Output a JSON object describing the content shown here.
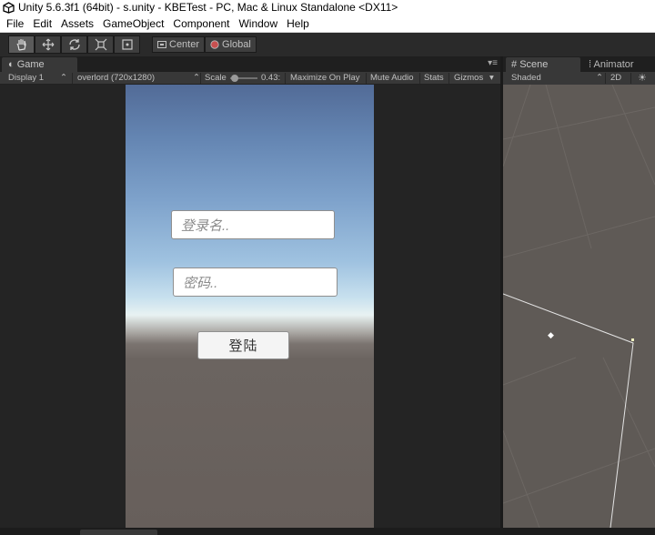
{
  "window": {
    "title": "Unity 5.6.3f1 (64bit) - s.unity - KBETest - PC, Mac & Linux Standalone <DX11>"
  },
  "menu": [
    "File",
    "Edit",
    "Assets",
    "GameObject",
    "Component",
    "Window",
    "Help"
  ],
  "toolbar": {
    "tools": [
      "hand-icon",
      "move-icon",
      "rotate-icon",
      "scale-icon",
      "rect-icon"
    ],
    "pivot_label": "Center",
    "space_label": "Global"
  },
  "game_panel": {
    "tab_label": "Game",
    "display": "Display 1",
    "resolution": "overlord (720x1280)",
    "scale_label": "Scale",
    "scale_value": "0.43:",
    "maximize_label": "Maximize On Play",
    "mute_label": "Mute Audio",
    "stats_label": "Stats",
    "gizmos_label": "Gizmos"
  },
  "login_form": {
    "username_placeholder": "登录名..",
    "password_placeholder": "密码..",
    "login_button": "登陆"
  },
  "scene_panel": {
    "tab_label": "Scene",
    "animator_label": "Animator",
    "shading": "Shaded",
    "mode_2d": "2D"
  }
}
